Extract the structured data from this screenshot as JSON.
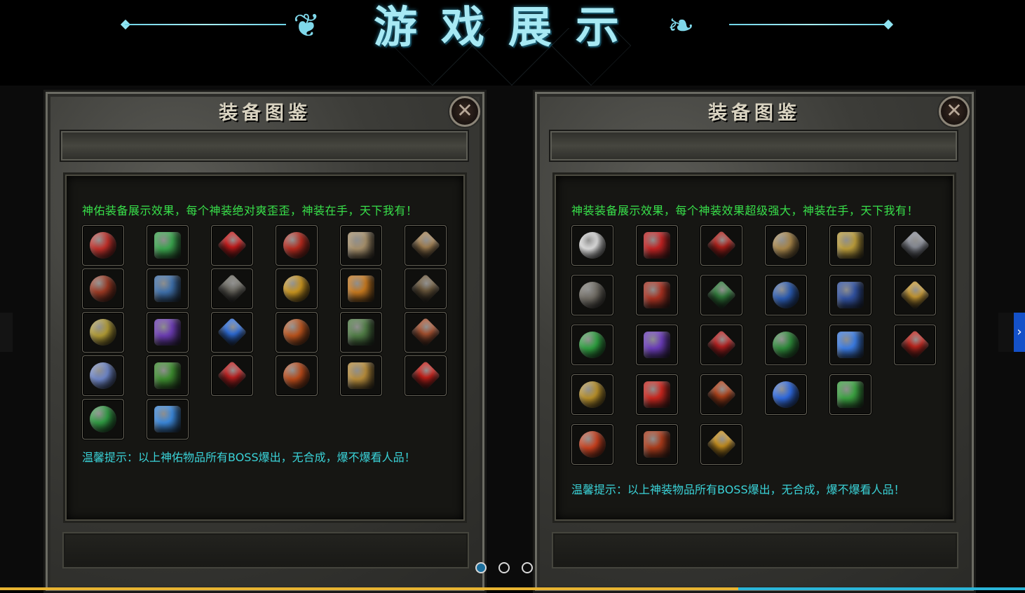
{
  "banner": {
    "title": "游戏展示"
  },
  "panels": [
    {
      "title": "装备图鉴",
      "intro": "神佑装备展示效果，每个神装绝对爽歪歪，神装在手，天下我有！",
      "tip": "温馨提示：以上神佑物品所有BOSS爆出，无合成，爆不爆看人品！",
      "close": "✕"
    },
    {
      "title": "装备图鉴",
      "intro": "神装装备展示效果，每个神装效果超级强大，神装在手，天下我有！",
      "tip": "温馨提示：以上神装物品所有BOSS爆出，无合成，爆不爆看人品！",
      "close": "✕"
    }
  ],
  "carousel": {
    "dots": 3,
    "active_index": 0,
    "next_icon": "›",
    "progress": 0.72
  },
  "colors": {
    "intro": "#38e04a",
    "tip": "#3ad3d8",
    "banner": "#a7e9f4",
    "accent": "#1451c9"
  },
  "items_left": [
    [
      "#c2302a",
      "#3aa34d",
      "#c81b1b",
      "#b62a1e",
      "#a48e6a",
      "#a48254"
    ],
    [
      "#9a3822",
      "#3d6ea8",
      "#6c6a62",
      "#c8941f",
      "#c2761e",
      "#6d5a3e"
    ],
    [
      "#b09a34",
      "#6a3bb0",
      "#2f6fdc",
      "#b8521c",
      "#4e7a44",
      "#a85230"
    ],
    [
      "#6e86c8",
      "#3c8a2e",
      "#c02020",
      "#b84a1a",
      "#b48a3a",
      "#c8201a"
    ],
    [
      "#2f9a42",
      "#3a86d8"
    ]
  ],
  "items_right": [
    [
      "#dcdcdc",
      "#c02222",
      "#b0201a",
      "#a8864a",
      "#b89a3a",
      "#8a8e98"
    ],
    [
      "#6e6a62",
      "#a53020",
      "#2f7a3a",
      "#2a5ab0",
      "#30509e",
      "#c89a34"
    ],
    [
      "#2ea040",
      "#6a3cb8",
      "#b82020",
      "#2e8a3a",
      "#3a7ae0",
      "#c0261e"
    ],
    [
      "#b8902a",
      "#c8261e",
      "#b0421a",
      "#2f6ae0",
      "#3aa040"
    ],
    [
      "#c8401e",
      "#a83a1a",
      "#c8901e"
    ]
  ]
}
